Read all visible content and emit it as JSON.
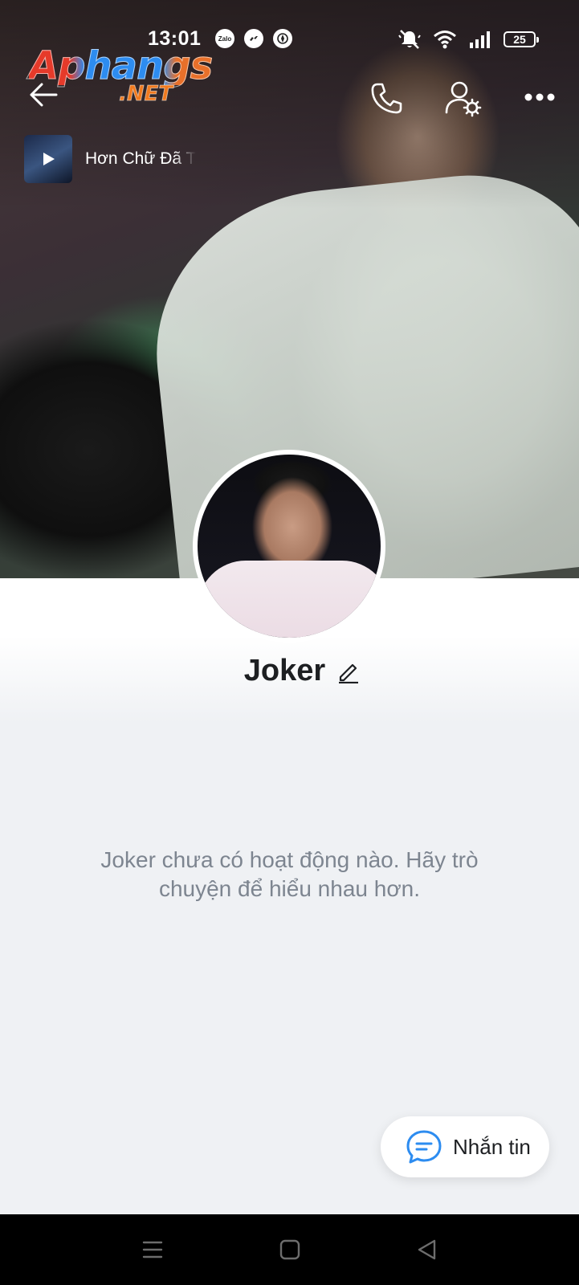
{
  "status_bar": {
    "time": "13:01",
    "app_icons": [
      "zalo-icon",
      "messenger-icon",
      "compass-icon"
    ],
    "zalo_label": "Zalo",
    "battery_level": "25",
    "indicators": [
      "mute-icon",
      "wifi-icon",
      "signal-icon"
    ]
  },
  "watermark": {
    "main": "Aphangs",
    "sub": ".NET"
  },
  "header": {
    "back_icon": "arrow-left-icon",
    "call_icon": "phone-icon",
    "settings_icon": "user-settings-icon",
    "more_icon": "more-dots-icon"
  },
  "music": {
    "title": "Hơn Chữ Đã T",
    "play_icon": "play-icon"
  },
  "profile": {
    "name": "Joker",
    "edit_icon": "pencil-icon"
  },
  "feed": {
    "empty_message": "Joker chưa có hoạt động nào. Hãy trò chuyện để hiểu nhau hơn."
  },
  "actions": {
    "message_label": "Nhắn tin",
    "message_icon": "chat-bubble-icon"
  },
  "colors": {
    "accent": "#2d8cf0",
    "text_primary": "#1d1f22",
    "text_muted": "#7d8590",
    "background": "#eff1f4"
  },
  "navigation": {
    "buttons": [
      "menu-icon",
      "home-square-icon",
      "back-triangle-icon"
    ]
  }
}
